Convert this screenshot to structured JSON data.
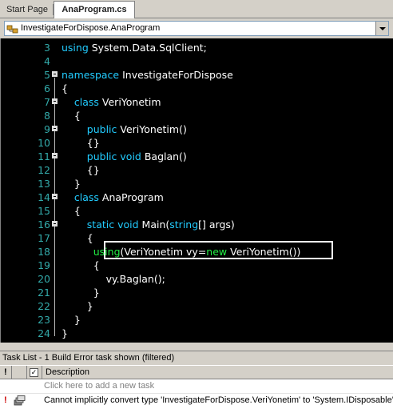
{
  "tabs": [
    {
      "label": "Start Page",
      "active": false
    },
    {
      "label": "AnaProgram.cs",
      "active": true
    }
  ],
  "navbar": {
    "selected": "InvestigateForDispose.AnaProgram"
  },
  "code_lines": [
    {
      "n": "3",
      "tokens": [
        [
          "kw",
          "using"
        ],
        [
          "t",
          " System.Data.SqlClient;"
        ]
      ]
    },
    {
      "n": "4",
      "tokens": []
    },
    {
      "n": "5",
      "tokens": [
        [
          "kw",
          "namespace"
        ],
        [
          "t",
          " InvestigateForDispose"
        ]
      ]
    },
    {
      "n": "6",
      "tokens": [
        [
          "t",
          "{"
        ]
      ]
    },
    {
      "n": "7",
      "tokens": [
        [
          "t",
          "    "
        ],
        [
          "kw",
          "class"
        ],
        [
          "t",
          " VeriYonetim"
        ]
      ]
    },
    {
      "n": "8",
      "tokens": [
        [
          "t",
          "    {"
        ]
      ]
    },
    {
      "n": "9",
      "tokens": [
        [
          "t",
          "        "
        ],
        [
          "kw",
          "public"
        ],
        [
          "t",
          " VeriYonetim()"
        ]
      ]
    },
    {
      "n": "10",
      "tokens": [
        [
          "t",
          "        {}"
        ]
      ]
    },
    {
      "n": "11",
      "tokens": [
        [
          "t",
          "        "
        ],
        [
          "kw",
          "public"
        ],
        [
          "t",
          " "
        ],
        [
          "kw",
          "void"
        ],
        [
          "t",
          " Baglan()"
        ]
      ]
    },
    {
      "n": "12",
      "tokens": [
        [
          "t",
          "        {}"
        ]
      ]
    },
    {
      "n": "13",
      "tokens": [
        [
          "t",
          "    }"
        ]
      ]
    },
    {
      "n": "14",
      "tokens": [
        [
          "t",
          "    "
        ],
        [
          "kw",
          "class"
        ],
        [
          "t",
          " AnaProgram"
        ]
      ]
    },
    {
      "n": "15",
      "tokens": [
        [
          "t",
          "    {"
        ]
      ]
    },
    {
      "n": "16",
      "tokens": [
        [
          "t",
          "        "
        ],
        [
          "kw",
          "static"
        ],
        [
          "t",
          " "
        ],
        [
          "kw",
          "void"
        ],
        [
          "t",
          " Main("
        ],
        [
          "kw",
          "string"
        ],
        [
          "t",
          "[] args)"
        ]
      ]
    },
    {
      "n": "17",
      "tokens": [
        [
          "t",
          "        {"
        ]
      ]
    },
    {
      "n": "18",
      "tokens": [
        [
          "t",
          "          "
        ],
        [
          "kw2",
          "using"
        ],
        [
          "t",
          "(VeriYonetim vy="
        ],
        [
          "kw2",
          "new"
        ],
        [
          "t",
          " VeriYonetim())"
        ]
      ]
    },
    {
      "n": "19",
      "tokens": [
        [
          "t",
          "          {"
        ]
      ]
    },
    {
      "n": "20",
      "tokens": [
        [
          "t",
          "              vy.Baglan();"
        ]
      ]
    },
    {
      "n": "21",
      "tokens": [
        [
          "t",
          "          }"
        ]
      ]
    },
    {
      "n": "22",
      "tokens": [
        [
          "t",
          "        }"
        ]
      ]
    },
    {
      "n": "23",
      "tokens": [
        [
          "t",
          "    }"
        ]
      ]
    },
    {
      "n": "24",
      "tokens": [
        [
          "t",
          "}"
        ]
      ]
    }
  ],
  "folds": [
    "5",
    "7",
    "9",
    "11",
    "14",
    "16"
  ],
  "tasklist": {
    "title": "Task List - 1 Build Error task shown (filtered)",
    "header": {
      "description": "Description"
    },
    "new_task_placeholder": "Click here to add a new task",
    "error": {
      "icon": "error-icon",
      "text": "Cannot implicitly convert type 'InvestigateForDispose.VeriYonetim' to 'System.IDisposable'"
    }
  },
  "colors": {
    "keyword": "#22ccff",
    "highlight_keyword": "#22ee44",
    "line_number": "#33aaaa",
    "editor_bg": "#000000"
  }
}
